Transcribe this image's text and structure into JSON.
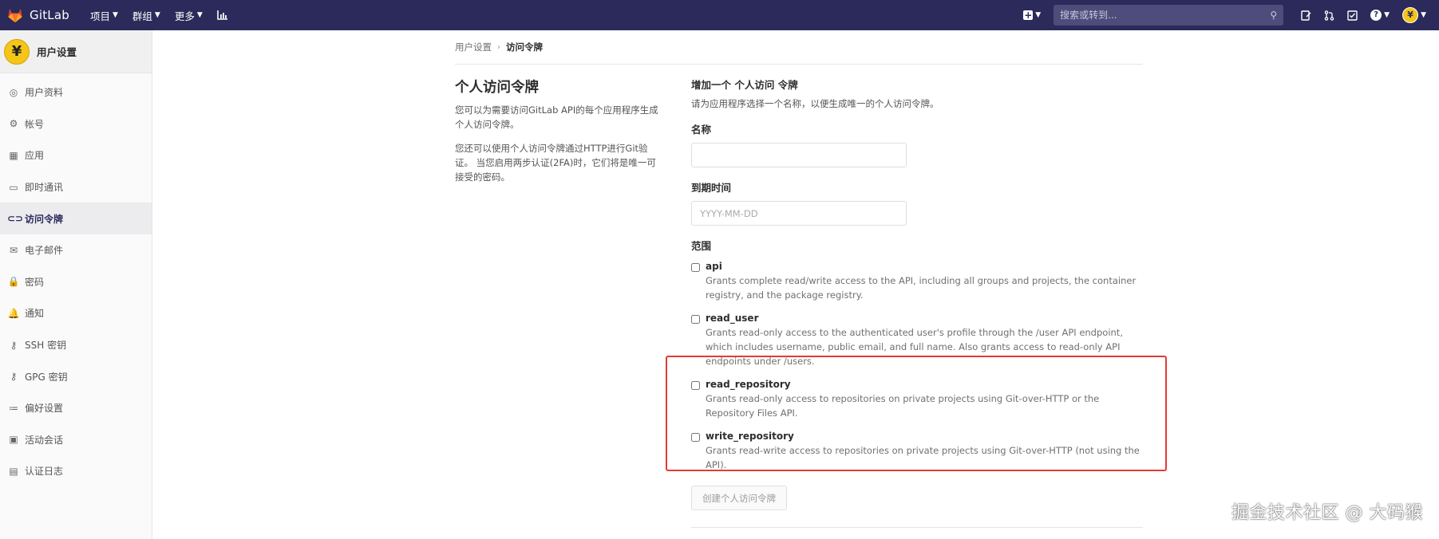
{
  "navbar": {
    "brand": "GitLab",
    "menu": [
      {
        "label": "项目",
        "has_dropdown": true
      },
      {
        "label": "群组",
        "has_dropdown": true
      },
      {
        "label": "更多",
        "has_dropdown": true
      }
    ],
    "search_placeholder": "搜索或转到...",
    "avatar_char": "¥"
  },
  "sidebar": {
    "title": "用户设置",
    "avatar_char": "¥",
    "items": [
      {
        "label": "用户资料",
        "icon": "profile-icon",
        "glyph": "◎",
        "active": false
      },
      {
        "label": "帐号",
        "icon": "account-icon",
        "glyph": "⚙",
        "active": false
      },
      {
        "label": "应用",
        "icon": "applications-icon",
        "glyph": "▦",
        "active": false
      },
      {
        "label": "即时通讯",
        "icon": "chat-icon",
        "glyph": "▭",
        "active": false
      },
      {
        "label": "访问令牌",
        "icon": "token-icon",
        "glyph": "⊂⊃",
        "active": true
      },
      {
        "label": "电子邮件",
        "icon": "email-icon",
        "glyph": "✉",
        "active": false
      },
      {
        "label": "密码",
        "icon": "lock-icon",
        "glyph": "🔒",
        "active": false
      },
      {
        "label": "通知",
        "icon": "notification-icon",
        "glyph": "🔔",
        "active": false
      },
      {
        "label": "SSH 密钥",
        "icon": "key-icon",
        "glyph": "⚷",
        "active": false
      },
      {
        "label": "GPG 密钥",
        "icon": "key-icon",
        "glyph": "⚷",
        "active": false
      },
      {
        "label": "偏好设置",
        "icon": "preferences-icon",
        "glyph": "≔",
        "active": false
      },
      {
        "label": "活动会话",
        "icon": "sessions-icon",
        "glyph": "▣",
        "active": false
      },
      {
        "label": "认证日志",
        "icon": "log-icon",
        "glyph": "▤",
        "active": false
      }
    ]
  },
  "breadcrumb": {
    "parent": "用户设置",
    "current": "访问令牌"
  },
  "intro": {
    "title": "个人访问令牌",
    "paragraph1": "您可以为需要访问GitLab API的每个应用程序生成个人访问令牌。",
    "paragraph2": "您还可以使用个人访问令牌通过HTTP进行Git验证。 当您启用两步认证(2FA)时，它们将是唯一可接受的密码。"
  },
  "form": {
    "heading": "增加一个 个人访问 令牌",
    "subheading": "请为应用程序选择一个名称，以便生成唯一的个人访问令牌。",
    "name_label": "名称",
    "name_value": "",
    "expires_label": "到期时间",
    "expires_placeholder": "YYYY-MM-DD",
    "scopes_label": "范围",
    "scopes": [
      {
        "name": "api",
        "checked": false,
        "description": "Grants complete read/write access to the API, including all groups and projects, the container registry, and the package registry."
      },
      {
        "name": "read_user",
        "checked": false,
        "description": "Grants read-only access to the authenticated user's profile through the /user API endpoint, which includes username, public email, and full name. Also grants access to read-only API endpoints under /users."
      },
      {
        "name": "read_repository",
        "checked": false,
        "description": "Grants read-only access to repositories on private projects using Git-over-HTTP or the Repository Files API."
      },
      {
        "name": "write_repository",
        "checked": false,
        "description": "Grants read-write access to repositories on private projects using Git-over-HTTP (not using the API)."
      }
    ],
    "submit_label": "创建个人访问令牌"
  },
  "watermark": "掘金技术社区 @ 大码猴",
  "colors": {
    "navbar_bg": "#2b2a5a",
    "highlight_border": "#e53935",
    "sidebar_active_bg": "#ececef"
  }
}
